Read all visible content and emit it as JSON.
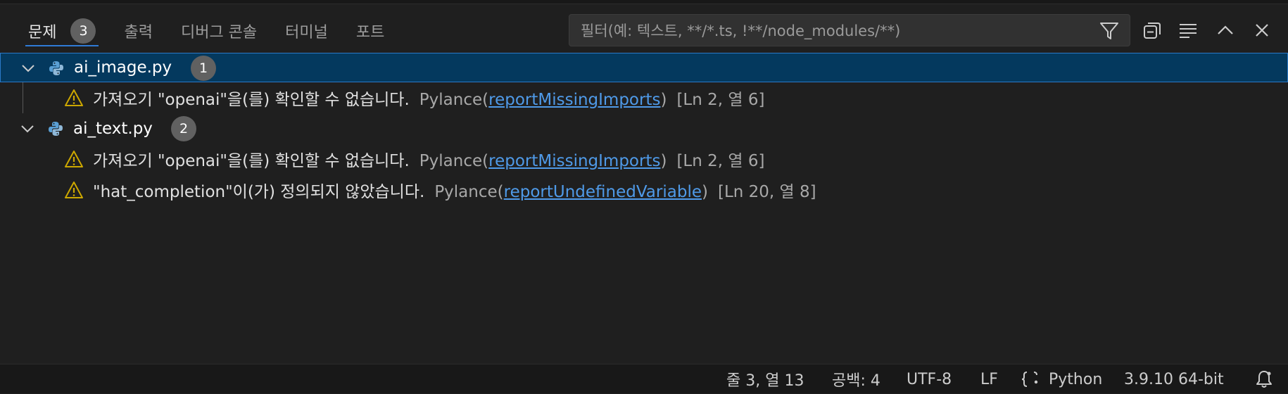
{
  "panel": {
    "tabs": [
      {
        "label": "문제",
        "badge": "3",
        "active": true
      },
      {
        "label": "출력"
      },
      {
        "label": "디버그 콘솔"
      },
      {
        "label": "터미널"
      },
      {
        "label": "포트"
      }
    ],
    "filter_placeholder": "필터(예: 텍스트, **/*.ts, !**/node_modules/**)",
    "icons": [
      "filter-icon",
      "collapse-all-icon",
      "view-as-list-icon",
      "chevron-up-icon",
      "close-icon"
    ]
  },
  "files": [
    {
      "name": "ai_image.py",
      "count": "1",
      "problems": [
        {
          "message": "가져오기 \"openai\"을(를) 확인할 수 없습니다.",
          "source": "Pylance",
          "code": "reportMissingImports",
          "location": "[Ln 2, 열 6]"
        }
      ]
    },
    {
      "name": "ai_text.py",
      "count": "2",
      "problems": [
        {
          "message": "가져오기 \"openai\"을(를) 확인할 수 없습니다.",
          "source": "Pylance",
          "code": "reportMissingImports",
          "location": "[Ln 2, 열 6]"
        },
        {
          "message": "\"hat_completion\"이(가) 정의되지 않았습니다.",
          "source": "Pylance",
          "code": "reportUndefinedVariable",
          "location": "[Ln 20, 열 8]"
        }
      ]
    }
  ],
  "statusbar": {
    "cursor": "줄 3, 열 13",
    "indent": "공백: 4",
    "encoding": "UTF-8",
    "eol": "LF",
    "language": "Python",
    "interpreter": "3.9.10 64-bit"
  },
  "colors": {
    "accent": "#2f7bd6",
    "warning": "#cca700",
    "link": "#4f9ae8",
    "selection": "#04395e"
  }
}
